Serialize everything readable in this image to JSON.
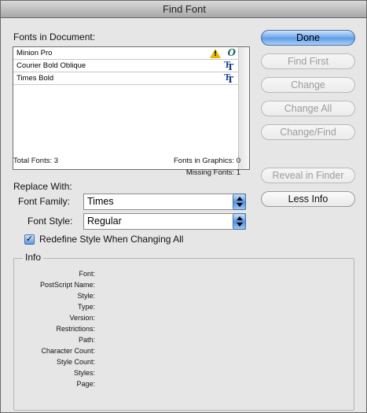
{
  "window": {
    "title": "Find Font"
  },
  "fonts_section": {
    "label": "Fonts in Document:",
    "fonts": [
      {
        "name": "Minion Pro",
        "status": "warning-icon",
        "type": "opentype-icon"
      },
      {
        "name": "Courier Bold Oblique",
        "type": "truetype-icon"
      },
      {
        "name": "Times Bold",
        "type": "truetype-icon"
      }
    ],
    "total_fonts": "Total Fonts: 3",
    "fonts_in_graphics": "Fonts in Graphics: 0",
    "missing_fonts": "Missing Fonts: 1"
  },
  "buttons": {
    "done": "Done",
    "find_first": "Find First",
    "change": "Change",
    "change_all": "Change All",
    "change_find": "Change/Find",
    "reveal_in_finder": "Reveal in Finder",
    "less_info": "Less Info"
  },
  "replace": {
    "label": "Replace With:",
    "family_label": "Font Family:",
    "family_value": "Times",
    "style_label": "Font Style:",
    "style_value": "Regular",
    "redefine_label": "Redefine Style When Changing All",
    "redefine_checked": true
  },
  "info": {
    "legend": "Info",
    "fields": [
      "Font:",
      "PostScript Name:",
      "Style:",
      "Type:",
      "Version:",
      "Restrictions:",
      "Path:",
      "Character Count:",
      "Style Count:",
      "Styles:",
      "Page:"
    ]
  },
  "colors": {
    "primary_button": "#5d9be6",
    "warning": "#e8b800",
    "truetype": "#2a56b8",
    "opentype": "#1b6a5c"
  }
}
